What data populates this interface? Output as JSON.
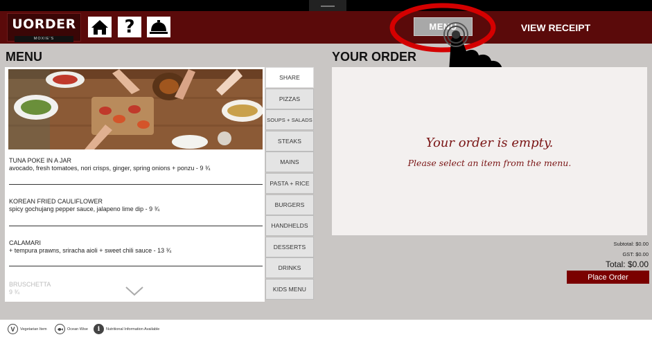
{
  "header": {
    "logo_text": "UORDER",
    "logo_sub": "MOXIE'S",
    "home_icon": "home-icon",
    "help_icon": "question-mark-icon",
    "help_glyph": "?",
    "service_icon": "service-bell-icon",
    "menu_label": "MENU",
    "view_receipt_label": "VIEW RECEIPT"
  },
  "menu": {
    "title": "MENU",
    "items": [
      {
        "name": "TUNA POKE IN A JAR",
        "description": "avocado, fresh tomatoes, nori crisps, ginger, spring onions + ponzu - 9 ¾"
      },
      {
        "name": "KOREAN FRIED CAULIFLOWER",
        "description": "spicy gochujang pepper sauce, jalapeno lime dip - 9 ¾"
      },
      {
        "name": "CALAMARI",
        "description": "+ tempura prawns, sriracha aioli + sweet chili sauce - 13 ¾"
      },
      {
        "name": "BRUSCHETTA",
        "description": "9 ¾"
      }
    ],
    "scroll_icon": "chevron-down-icon"
  },
  "categories": [
    "SHARE",
    "PIZZAS",
    "SOUPS + SALADS",
    "STEAKS",
    "MAINS",
    "PASTA + RICE",
    "BURGERS",
    "HANDHELDS",
    "DESSERTS",
    "DRINKS",
    "KIDS MENU"
  ],
  "active_category": "SHARE",
  "order": {
    "title": "YOUR ORDER",
    "empty_title": "Your order is empty.",
    "empty_sub": "Please select an item from the menu.",
    "subtotal": "Subtotal: $0.00",
    "gst": "GST: $0.00",
    "total": "Total: $0.00",
    "place_order_label": "Place Order"
  },
  "footer": {
    "legend": [
      {
        "icon": "vegetarian-icon",
        "glyph": "V",
        "label": "Vegetarian Item"
      },
      {
        "icon": "ocean-wise-icon",
        "glyph": "",
        "label": "Ocean Wise"
      },
      {
        "icon": "info-icon",
        "glyph": "i",
        "label": "Nutritional Information Available"
      }
    ]
  },
  "colors": {
    "header_bg": "#5a0a0a",
    "accent": "#7a0000",
    "highlight_ring": "#d40000"
  }
}
